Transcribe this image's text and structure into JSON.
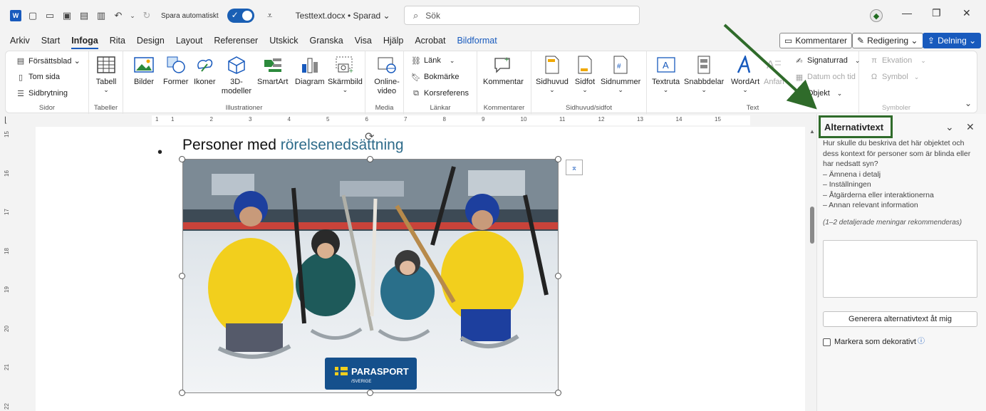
{
  "titlebar": {
    "autosave_label": "Spara automatiskt",
    "doc_title": "Testtext.docx • Sparad ⌄",
    "search_placeholder": "Sök"
  },
  "menu": {
    "tabs": [
      "Arkiv",
      "Start",
      "Infoga",
      "Rita",
      "Design",
      "Layout",
      "Referenser",
      "Utskick",
      "Granska",
      "Visa",
      "Hjälp",
      "Acrobat",
      "Bildformat"
    ],
    "active": "Infoga",
    "comments_label": "Kommentarer",
    "editing_label": "Redigering ⌄",
    "share_label": "Delning ⌄"
  },
  "ribbon": {
    "sidor": {
      "label": "Sidor",
      "items": [
        "Försättsblad ⌄",
        "Tom sida",
        "Sidbrytning"
      ]
    },
    "tabeller": {
      "label": "Tabeller",
      "table": "Tabell"
    },
    "illustrationer": {
      "label": "Illustrationer",
      "items": [
        "Bilder",
        "Former",
        "Ikoner",
        "3D-modeller",
        "SmartArt",
        "Diagram",
        "Skärmbild"
      ]
    },
    "media": {
      "label": "Media",
      "online_video": "Online-video"
    },
    "lankar": {
      "label": "Länkar",
      "items": [
        "Länk",
        "Bokmärke",
        "Korsreferens"
      ]
    },
    "kommentarer": {
      "label": "Kommentarer",
      "comment": "Kommentar"
    },
    "sidhuvud": {
      "label": "Sidhuvud/sidfot",
      "items": [
        "Sidhuvud",
        "Sidfot",
        "Sidnummer"
      ]
    },
    "text": {
      "label": "Text",
      "items": [
        "Textruta",
        "Snabbdelar",
        "WordArt",
        "Anfang"
      ],
      "small": [
        "Signaturrad",
        "Datum och tid",
        "Objekt"
      ]
    },
    "symboler": {
      "label": "Symboler",
      "items": [
        "Ekvation",
        "Symbol"
      ]
    }
  },
  "ruler": {
    "h_numbers": [
      "1",
      "1",
      "2",
      "3",
      "4",
      "5",
      "6",
      "7",
      "8",
      "9",
      "10",
      "11",
      "12",
      "13",
      "14",
      "15"
    ],
    "v_numbers": [
      "15",
      "16",
      "17",
      "18",
      "19",
      "20",
      "21",
      "22"
    ]
  },
  "document": {
    "bullet_text": "Personer med ",
    "bullet_link": "rörelsenedsättning",
    "logo_text": "PARASPORT",
    "logo_sub": "/SVERIGE"
  },
  "pane": {
    "title": "Alternativtext",
    "description_lines": [
      "Hur skulle du beskriva det här objektet och dess kontext för personer som är blinda eller har nedsatt syn?",
      "– Ämnena i detalj",
      "– Inställningen",
      "– Åtgärderna eller interaktionerna",
      "– Annan relevant information"
    ],
    "hint": "(1–2 detaljerade meningar rekommenderas)",
    "generate_button": "Generera alternativtext åt mig",
    "decorative_label": "Markera som dekorativt"
  },
  "colors": {
    "accent": "#185abd",
    "annotation_green": "#2f6b2a",
    "link": "#2e6b8a"
  }
}
